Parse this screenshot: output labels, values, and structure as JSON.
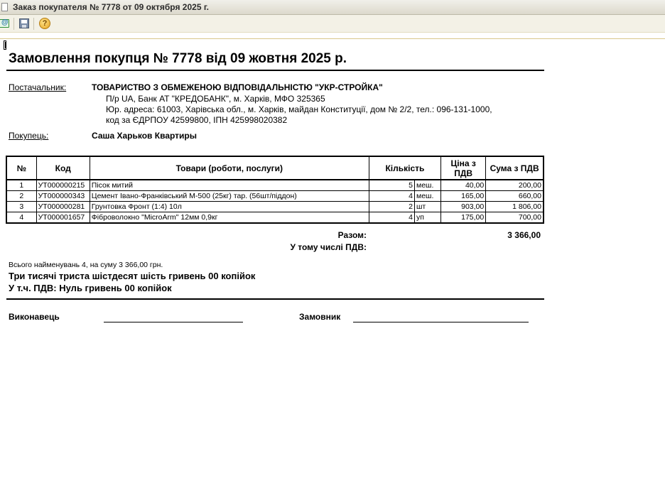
{
  "window": {
    "title": "Заказ покупателя № 7778 от 09 октября 2025 г."
  },
  "toolbar": {
    "buttons": [
      {
        "icon": "email-icon"
      },
      {
        "icon": "save-icon"
      },
      {
        "icon": "help-icon"
      }
    ]
  },
  "document": {
    "title": "Замовлення покупця № 7778 від 09 жовтня 2025 р.",
    "supplier": {
      "label": "Постачальник:",
      "name": "ТОВАРИСТВО З ОБМЕЖЕНОЮ ВІДПОВІДАЛЬНІСТЮ \"УКР-СТРОЙКА\"",
      "line1": "П/р UA, Банк АТ \"КРЕДОБАНК\", м. Харків, МФО 325365",
      "line2": "Юр. адреса: 61003, Харівська обл., м. Харків, майдан Конституції, дом № 2/2, тел.: 096-131-1000,",
      "line3": "код за ЄДРПОУ 42599800, ІПН 425998020382"
    },
    "buyer": {
      "label": "Покупець:",
      "name": "Саша Харьков Квартиры"
    },
    "table": {
      "headers": {
        "num": "№",
        "code": "Код",
        "goods": "Товари (роботи, послуги)",
        "qty": "Кількість",
        "price": "Ціна з ПДВ",
        "sum": "Сума з ПДВ"
      },
      "rows": [
        {
          "num": "1",
          "code": "УТ000000215",
          "name": "Пісок митий",
          "qty": "5",
          "unit": "меш.",
          "price": "40,00",
          "sum": "200,00"
        },
        {
          "num": "2",
          "code": "УТ000000343",
          "name": "Цемент Івано-Франківський М-500 (25кг) тар. (56шт/піддон)",
          "qty": "4",
          "unit": "меш.",
          "price": "165,00",
          "sum": "660,00"
        },
        {
          "num": "3",
          "code": "УТ000000281",
          "name": "Грунтовка Фронт (1:4) 10л",
          "qty": "2",
          "unit": "шт",
          "price": "903,00",
          "sum": "1 806,00"
        },
        {
          "num": "4",
          "code": "УТ000001657",
          "name": "Фіброволокно \"MicroArm\" 12мм 0,9кг",
          "qty": "4",
          "unit": "уп",
          "price": "175,00",
          "sum": "700,00"
        }
      ]
    },
    "totals": {
      "total_label": "Разом:",
      "total_value": "3 366,00",
      "vat_label": "У тому числі ПДВ:",
      "vat_value": ""
    },
    "summary": {
      "count_line": "Всього найменувань 4, на суму 3 366,00 грн.",
      "amount_words": "Три тисячі триста шістдесят шість гривень 00 копійок",
      "vat_words": "У т.ч. ПДВ: Нуль гривень 00 копійок"
    },
    "signatures": {
      "executor_label": "Виконавець",
      "customer_label": "Замовник"
    }
  }
}
